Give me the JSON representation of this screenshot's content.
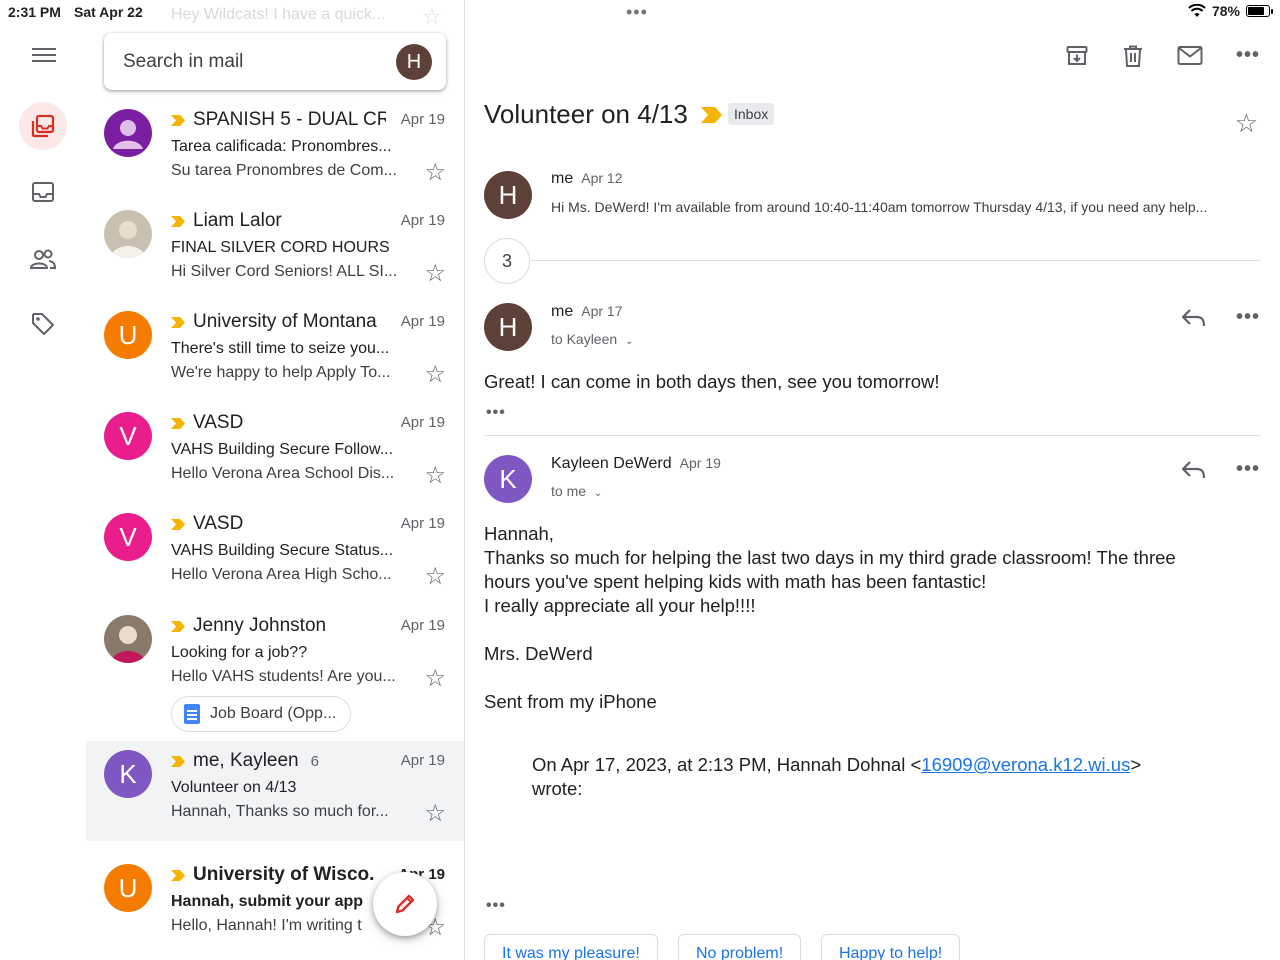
{
  "status_bar": {
    "time": "2:31 PM",
    "date": "Sat Apr 22",
    "battery": "78%",
    "battery_level": 0.78,
    "multitask": "•••"
  },
  "rail": {
    "items": [
      "mail-stack",
      "inbox",
      "contacts",
      "labels"
    ]
  },
  "list": {
    "ghost_snippet": "Hey Wildcats! I have a quick...",
    "search": {
      "placeholder": "Search in mail",
      "avatar_letter": "H"
    },
    "rows": [
      {
        "sender": "SPANISH 5 - DUAL CR.",
        "date": "Apr 19",
        "subject": "Tarea calificada: Pronombres...",
        "snippet": "Su tarea Pronombres de Com...",
        "avatar_letter": "",
        "avatar_color": "#7b1fa2"
      },
      {
        "sender": "Liam Lalor",
        "date": "Apr 19",
        "subject": "FINAL SILVER CORD HOURS",
        "snippet": "Hi Silver Cord Seniors! ALL SI...",
        "avatar_letter": "",
        "avatar_color": "#c9c0b0"
      },
      {
        "sender": "University of Montana",
        "date": "Apr 19",
        "subject": "There's still time to seize you...",
        "snippet": "We're happy to help Apply To...",
        "avatar_letter": "U",
        "avatar_color": "#f57c00"
      },
      {
        "sender": "VASD",
        "date": "Apr 19",
        "subject": "VAHS Building Secure Follow...",
        "snippet": "Hello Verona Area School Dis...",
        "avatar_letter": "V",
        "avatar_color": "#e91e8c"
      },
      {
        "sender": "VASD",
        "date": "Apr 19",
        "subject": "VAHS Building Secure Status...",
        "snippet": "Hello Verona Area High Scho...",
        "avatar_letter": "V",
        "avatar_color": "#e91e8c"
      },
      {
        "sender": "Jenny Johnston",
        "date": "Apr 19",
        "subject": "Looking for a job??",
        "snippet": "Hello VAHS students! Are you...",
        "avatar_letter": "",
        "avatar_color": "#8a7a6a",
        "attachment": "Job Board (Opp..."
      },
      {
        "sender": "me, Kayleen",
        "count": "6",
        "date": "Apr 19",
        "subject": "Volunteer on 4/13",
        "snippet": "Hannah, Thanks so much for...",
        "avatar_letter": "K",
        "avatar_color": "#7e57c2"
      },
      {
        "sender": "University of Wisco.",
        "date": "Apr 19",
        "subject": "Hannah, submit your app",
        "snippet": "Hello, Hannah! I'm writing t",
        "avatar_letter": "U",
        "avatar_color": "#f57c00"
      }
    ]
  },
  "thread": {
    "title": "Volunteer on 4/13",
    "label": "Inbox",
    "collapsed_count": "3",
    "messages": [
      {
        "from": "me",
        "date": "Apr 12",
        "preview": "Hi Ms. DeWerd! I'm available from around 10:40-11:40am tomorrow Thursday 4/13, if you need any help...",
        "avatar_letter": "H"
      },
      {
        "from": "me",
        "date": "Apr 17",
        "to": "to Kayleen",
        "body": "Great! I can come in both days then, see you tomorrow!",
        "avatar_letter": "H"
      },
      {
        "from": "Kayleen DeWerd",
        "date": "Apr 19",
        "to": "to me",
        "avatar_letter": "K",
        "body_lines": [
          "Hannah,",
          "Thanks so much for helping the last two days in my third grade classroom! The three",
          "hours you've spent helping kids with math has been fantastic!",
          "I really appreciate all your help!!!!",
          "",
          "Mrs. DeWerd",
          "",
          "Sent from my iPhone"
        ],
        "quote_prefix": "On Apr 17, 2023, at 2:13 PM, Hannah Dohnal <",
        "quote_email": "16909@verona.k12.wi.us",
        "quote_suffix": ">",
        "quote_line2": "wrote:"
      }
    ],
    "smart_replies": [
      "It was my pleasure!",
      "No problem!",
      "Happy to help!"
    ]
  },
  "colors": {
    "accent": "#1a73e8",
    "important": "#f4b400",
    "compose": "#d93025",
    "me_avatar": "#5d4037",
    "kayleen_avatar": "#7e57c2"
  }
}
